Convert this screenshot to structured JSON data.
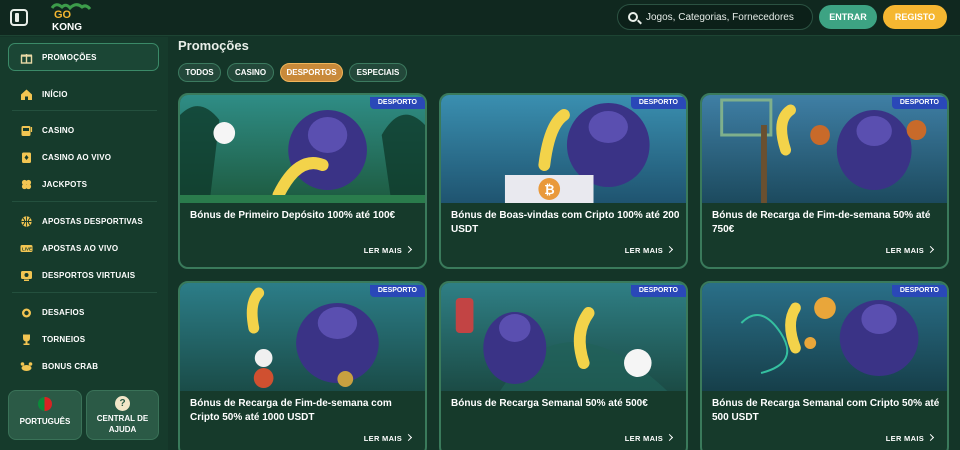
{
  "header": {
    "logo_text": "GO KONG",
    "search_placeholder": "Jogos, Categorias, Fornecedores",
    "login_label": "ENTRAR",
    "register_label": "REGISTO"
  },
  "sidebar": {
    "active_item": "PROMOÇÕES",
    "items": [
      {
        "label": "INÍCIO",
        "icon": "home-icon"
      },
      {
        "label": "CASINO",
        "icon": "slot-machine-icon"
      },
      {
        "label": "CASINO AO VIVO",
        "icon": "cards-icon"
      },
      {
        "label": "JACKPOTS",
        "icon": "clover-icon"
      },
      {
        "label": "APOSTAS DESPORTIVAS",
        "icon": "basketball-icon"
      },
      {
        "label": "APOSTAS AO VIVO",
        "icon": "live-icon"
      },
      {
        "label": "DESPORTOS VIRTUAIS",
        "icon": "virtual-sports-icon"
      },
      {
        "label": "DESAFIOS",
        "icon": "medal-icon"
      },
      {
        "label": "TORNEIOS",
        "icon": "trophy-icon"
      },
      {
        "label": "BONUS CRAB",
        "icon": "crab-icon"
      }
    ],
    "language_label": "PORTUGUÊS",
    "help_label_line1": "CENTRAL DE",
    "help_label_line2": "AJUDA",
    "help_icon_glyph": "?"
  },
  "main": {
    "title": "Promoções",
    "filters": [
      "TODOS",
      "CASINO",
      "DESPORTOS",
      "ESPECIAIS"
    ],
    "active_filter": "DESPORTOS",
    "read_more_label": "LER MAIS",
    "cards": [
      {
        "badge": "DESPORTO",
        "title": "Bónus de Primeiro Depósito 100% até 100€"
      },
      {
        "badge": "DESPORTO",
        "title": "Bónus de Boas-vindas com Cripto 100% até 200 USDT"
      },
      {
        "badge": "DESPORTO",
        "title": "Bónus de Recarga de Fim-de-semana 50% até 750€"
      },
      {
        "badge": "DESPORTO",
        "title": "Bónus de Recarga de Fim-de-semana com Cripto 50% até 1000 USDT"
      },
      {
        "badge": "DESPORTO",
        "title": "Bónus de Recarga Semanal 50% até 500€"
      },
      {
        "badge": "DESPORTO",
        "title": "Bónus de Recarga Semanal com Cripto 50% até 500 USDT"
      }
    ]
  },
  "colors": {
    "background": "#143528",
    "accent_green": "#3da383",
    "accent_gold": "#f5b731",
    "badge_blue": "#2a48b8",
    "card_border": "#3a7a5b"
  }
}
